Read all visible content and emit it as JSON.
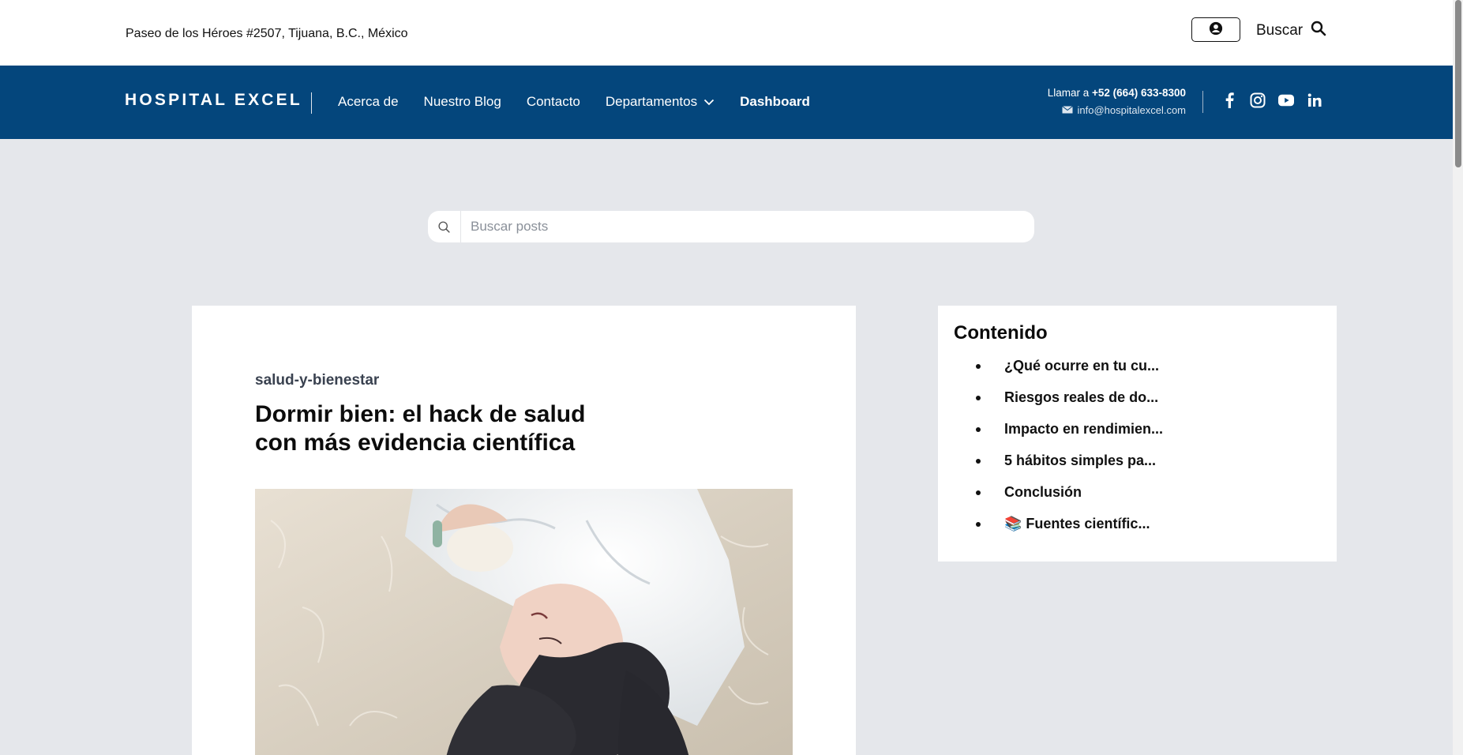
{
  "topbar": {
    "address": "Paseo de los Héroes #2507, Tijuana, B.C., México",
    "account_icon": "user-circle-icon",
    "search_label": "Buscar",
    "search_icon": "search-icon"
  },
  "navbar": {
    "logo": "HOSPITAL EXCEL",
    "links": [
      {
        "label": "Acerca de"
      },
      {
        "label": "Nuestro Blog"
      },
      {
        "label": "Contacto"
      },
      {
        "label": "Departamentos",
        "has_dropdown": true
      },
      {
        "label": "Dashboard",
        "active": true
      }
    ],
    "call_prefix": "Llamar a",
    "phone": "+52 (664) 633-8300",
    "email": "info@hospitalexcel.com",
    "socials": [
      "facebook-icon",
      "instagram-icon",
      "youtube-icon",
      "linkedin-icon"
    ],
    "color": "#04467c"
  },
  "search": {
    "placeholder": "Buscar posts"
  },
  "article": {
    "category": "salud-y-bienestar",
    "title": "Dormir bien: el hack de salud con más evidencia científica",
    "image_alt": "woman-sleeping-photo"
  },
  "toc": {
    "title": "Contenido",
    "items": [
      "¿Qué ocurre en tu cu...",
      "Riesgos reales de do...",
      "Impacto en rendimien...",
      "5 hábitos simples pa...",
      "Conclusión",
      "📚 Fuentes científic..."
    ]
  },
  "colors": {
    "page_bg": "#e5e7eb",
    "nav_bg": "#04467c"
  }
}
